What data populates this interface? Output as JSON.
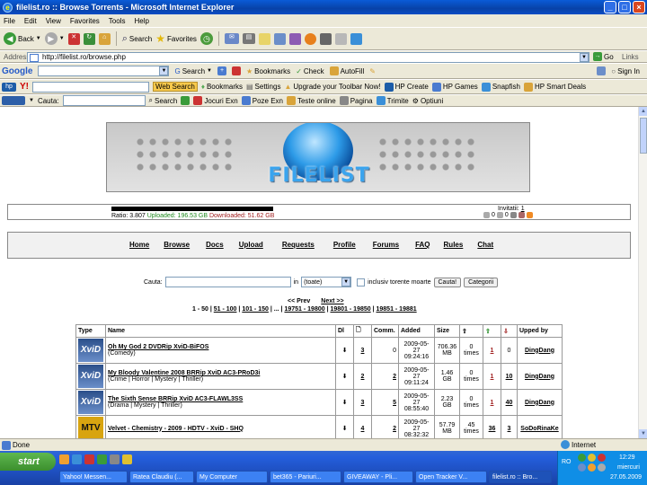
{
  "window": {
    "title": "filelist.ro :: Browse Torrents - Microsoft Internet Explorer"
  },
  "menu": [
    "File",
    "Edit",
    "View",
    "Favorites",
    "Tools",
    "Help"
  ],
  "toolbar": {
    "back": "Back",
    "search": "Search",
    "favorites": "Favorites"
  },
  "address": {
    "label": "Address",
    "url": "http://filelist.ro/browse.php",
    "go": "Go",
    "links": "Links"
  },
  "google_bar": {
    "brand": "Google",
    "search": "Search",
    "bookmarks": "Bookmarks",
    "check": "Check",
    "autofill": "AutoFill",
    "sign_in": "Sign In"
  },
  "hp_bar": {
    "web_search": "Web Search",
    "bookmarks": "Bookmarks",
    "settings": "Settings",
    "upgrade": "Upgrade your Toolbar Now!",
    "hp_create": "HP Create",
    "hp_games": "HP Games",
    "snapfish": "Snapfish",
    "hp_smart": "HP Smart Deals"
  },
  "cauta_bar": {
    "label": "Cauta:",
    "search": "Search",
    "jocuri": "Jocuri Exn",
    "poze": "Poze Exn",
    "teste": "Teste online",
    "pagina": "Pagina",
    "trimite": "Trimite",
    "optiuni": "Optiuni"
  },
  "site": {
    "logo": "FILELIST",
    "ratio_label": "Ratio: 3.807",
    "uploaded": "Uploaded: 196.53 GB",
    "downloaded": "Downloaded: 51.62 GB",
    "invitatii_label": "Invitatii:",
    "invitatii_value": "1",
    "icon_counts": [
      "0",
      "0"
    ]
  },
  "nav": [
    "Home",
    "Browse",
    "Docs",
    "Upload",
    "Requests",
    "Profile",
    "Forums",
    "FAQ",
    "Rules",
    "Chat"
  ],
  "search": {
    "label": "Cauta:",
    "in_label": "in",
    "select": "(toate)",
    "checkbox_label": "inclusiv torente moarte",
    "button": "Cauta!",
    "categories": "Categorii"
  },
  "pager": {
    "prev": "<< Prev",
    "next": "Next >>",
    "pages": [
      "1 - 50",
      "51 - 100",
      "101 - 150",
      "...",
      "19751 - 19800",
      "19801 - 19850",
      "19851 - 19881"
    ]
  },
  "table": {
    "headers": [
      "Type",
      "Name",
      "Dl",
      "",
      "Comm.",
      "Added",
      "Size",
      "",
      "",
      "",
      "Upped by"
    ],
    "rows": [
      {
        "type": "XviD",
        "name": "Oh My God 2 DVDRip XviD-BiFOS",
        "genre": "(Comedy)",
        "files": "3",
        "comments": "0",
        "added_date": "2009-05-27",
        "added_time": "09:24:16",
        "size": "706.36",
        "size_unit": "MB",
        "snatched": "0",
        "snatched_unit": "times",
        "seeders": "1",
        "leechers": "0",
        "upped_by": "DingDang"
      },
      {
        "type": "XviD",
        "name": "My Bloody Valentine 2008 BRRip XviD AC3-PRoD3i",
        "genre": "(Crime | Horror | Mystery | Thriller)",
        "files": "2",
        "comments": "2",
        "added_date": "2009-05-27",
        "added_time": "09:11:24",
        "size": "1.46",
        "size_unit": "GB",
        "snatched": "0",
        "snatched_unit": "times",
        "seeders": "1",
        "leechers": "10",
        "upped_by": "DingDang"
      },
      {
        "type": "XviD",
        "name": "The Sixth Sense BRRip XviD AC3-FLAWL3SS",
        "genre": "(Drama | Mystery | Thriller)",
        "files": "3",
        "comments": "5",
        "added_date": "2009-05-27",
        "added_time": "08:55:40",
        "size": "2.23",
        "size_unit": "GB",
        "snatched": "0",
        "snatched_unit": "times",
        "seeders": "1",
        "leechers": "40",
        "upped_by": "DingDang"
      },
      {
        "type": "MTV",
        "name": "Velvet - Chemistry - 2009 - HDTV - XviD - SHQ",
        "genre": "",
        "files": "4",
        "comments": "2",
        "added_date": "2009-05-27",
        "added_time": "08:32:32",
        "size": "57.79",
        "size_unit": "MB",
        "snatched": "45",
        "snatched_unit": "times",
        "seeders": "36",
        "leechers": "3",
        "upped_by": "SoDoRinaKe"
      }
    ]
  },
  "status": {
    "left": "Done",
    "zone": "Internet"
  },
  "taskbar": {
    "start": "start",
    "tasks": [
      "Yahoo! Messen...",
      "Ratea Claudiu (...",
      "My Computer",
      "bet365 - Pariuri...",
      "GIVEAWAY - Pli...",
      "Open Tracker V...",
      "filelist.ro :: Bro..."
    ],
    "lang": "RO",
    "time": "12:29",
    "day": "miercuri",
    "date": "27.05.2009"
  }
}
